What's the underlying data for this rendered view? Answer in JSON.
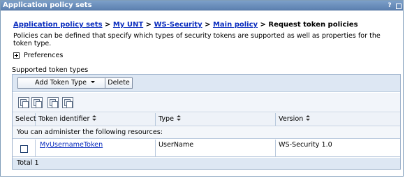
{
  "portlet": {
    "title": "Application policy sets",
    "help_label": "?"
  },
  "breadcrumb": {
    "items": [
      "Application policy sets",
      "My UNT",
      "WS-Security",
      "Main policy"
    ],
    "separator": ">",
    "current": "Request token policies"
  },
  "description": "Policies can be defined that specify which types of security tokens are supported as well as properties for the token type.",
  "preferences": {
    "label": "Preferences"
  },
  "section": {
    "label": "Supported token types"
  },
  "toolbar": {
    "add_label": "Add Token Type",
    "delete_label": "Delete"
  },
  "icon_toolbar": {
    "icons": [
      "select-all-icon",
      "deselect-all-icon",
      "show-filter-icon",
      "clear-filter-icon"
    ]
  },
  "table": {
    "columns": [
      "Select",
      "Token identifier",
      "Type",
      "Version"
    ],
    "resource_note": "You can administer the following resources:",
    "rows": [
      {
        "token_identifier": "MyUsernameToken",
        "type": "UserName",
        "version": "WS-Security 1.0",
        "selected": false
      }
    ],
    "total_label": "Total 1"
  }
}
